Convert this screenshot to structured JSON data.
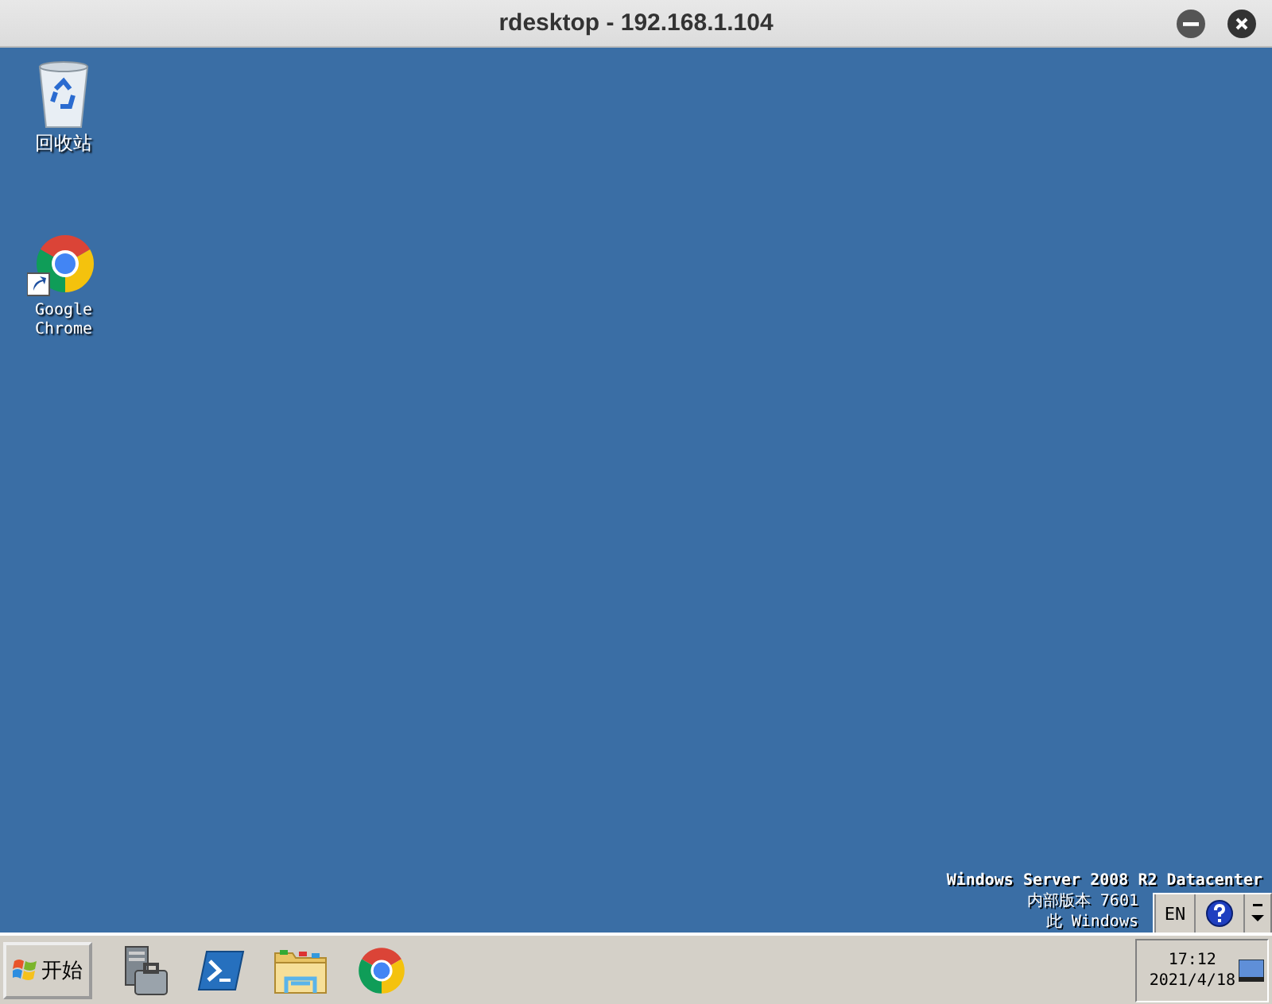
{
  "window": {
    "title": "rdesktop - 192.168.1.104"
  },
  "desktop_icons": [
    {
      "kind": "recycle-bin",
      "label": "回收站"
    },
    {
      "kind": "chrome-shortcut",
      "label": "Google Chrome"
    }
  ],
  "system_text": [
    "Windows Server 2008 R2 Datacenter",
    "内部版本 7601",
    "此 Windows"
  ],
  "taskbar": {
    "start": "开始",
    "quick_launch": [
      {
        "kind": "server-manager"
      },
      {
        "kind": "powershell"
      },
      {
        "kind": "explorer"
      },
      {
        "kind": "chrome"
      }
    ],
    "language": "EN",
    "clock": {
      "time": "17:12",
      "date": "2021/4/18"
    }
  }
}
